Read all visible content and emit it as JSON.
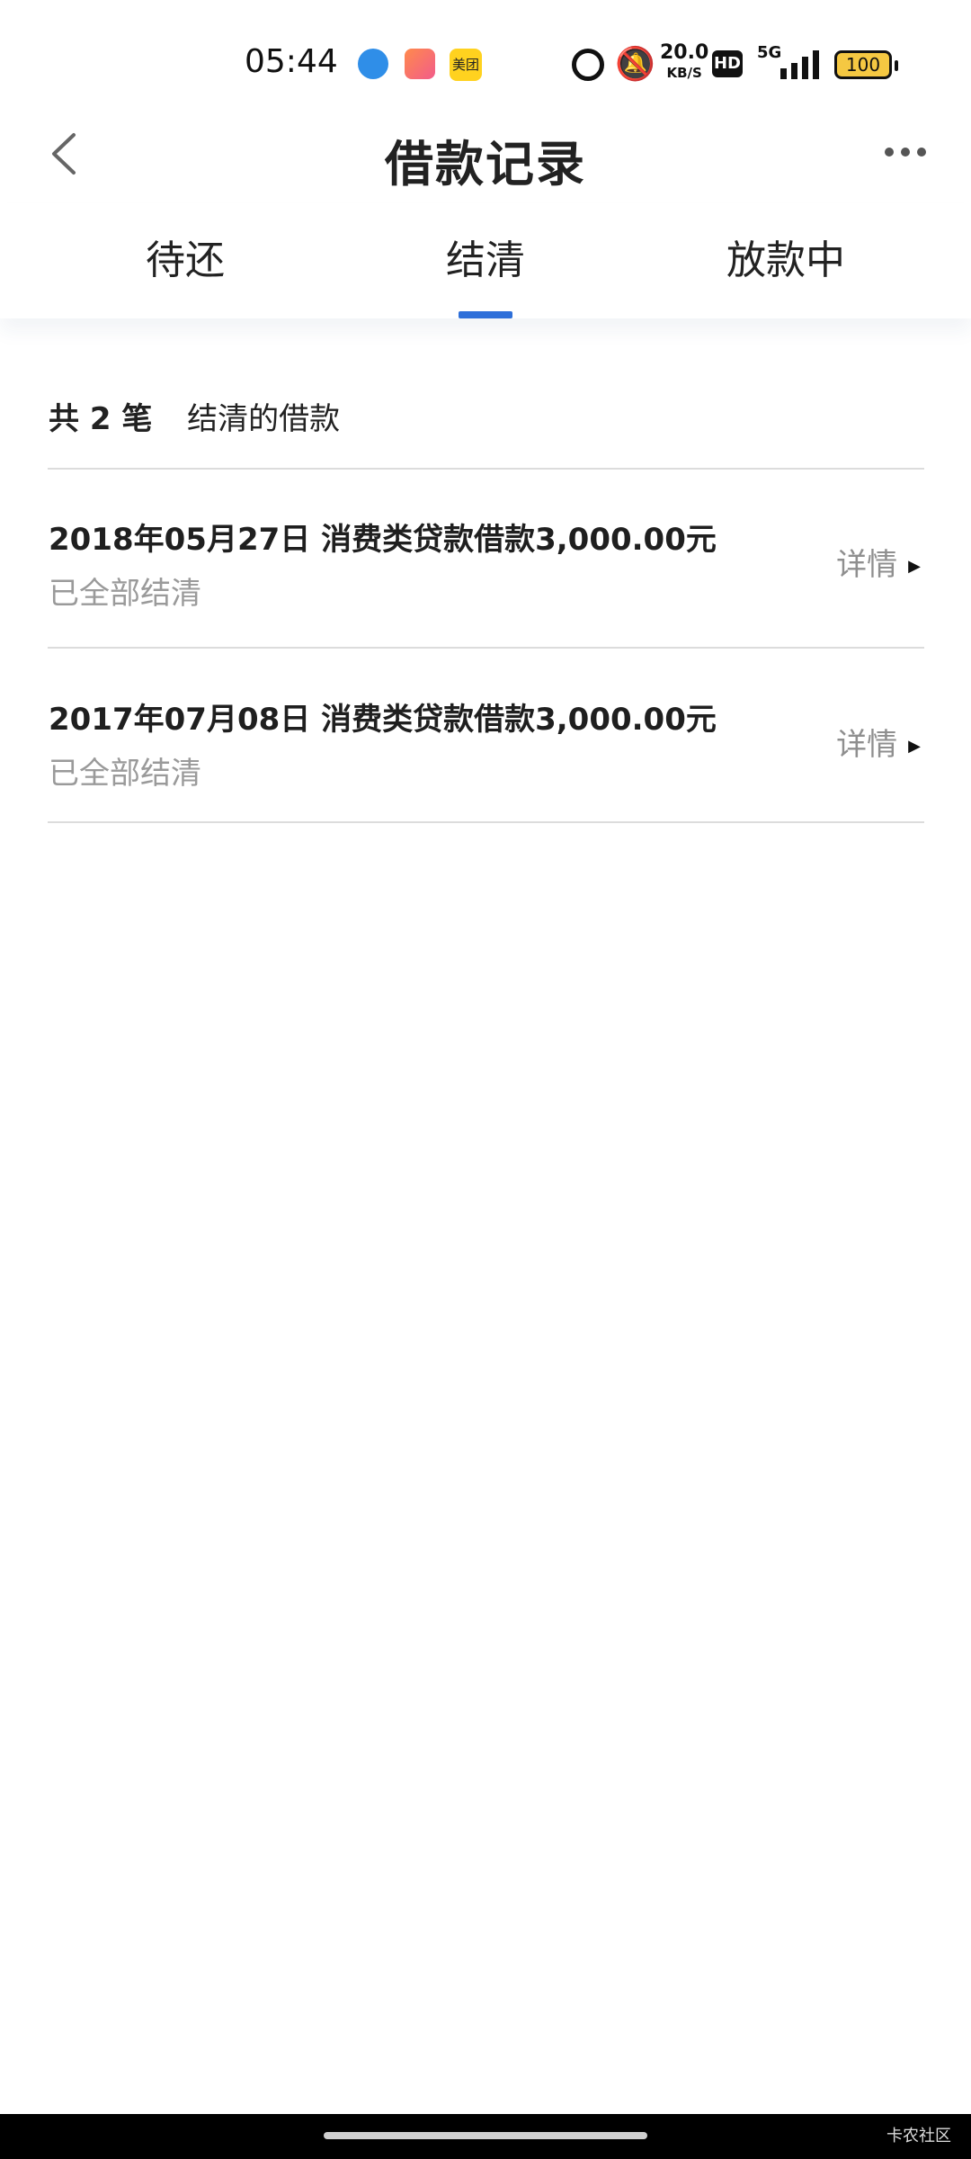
{
  "status_bar": {
    "time": "05:44",
    "meituan_badge": "美团",
    "network_speed": "20.0",
    "network_unit": "KB/S",
    "hd_label": "HD",
    "signal_label": "5G",
    "battery": "100"
  },
  "nav": {
    "title": "借款记录",
    "back_icon": "chevron-left-icon",
    "more_icon": "more-dots-icon"
  },
  "tabs": [
    {
      "label": "待还",
      "active": false
    },
    {
      "label": "结清",
      "active": true
    },
    {
      "label": "放款中",
      "active": false
    }
  ],
  "summary": {
    "count_text": "共 2 笔",
    "label": "结清的借款"
  },
  "loans": [
    {
      "title": "2018年05月27日 消费类贷款借款3,000.00元",
      "status": "已全部结清",
      "detail_label": "详情"
    },
    {
      "title": "2017年07月08日 消费类贷款借款3,000.00元",
      "status": "已全部结清",
      "detail_label": "详情"
    }
  ],
  "watermark": "卡农社区",
  "colors": {
    "accent": "#2e6fd9",
    "divider": "#dcdcdc",
    "muted_text": "#9a9a9a"
  }
}
